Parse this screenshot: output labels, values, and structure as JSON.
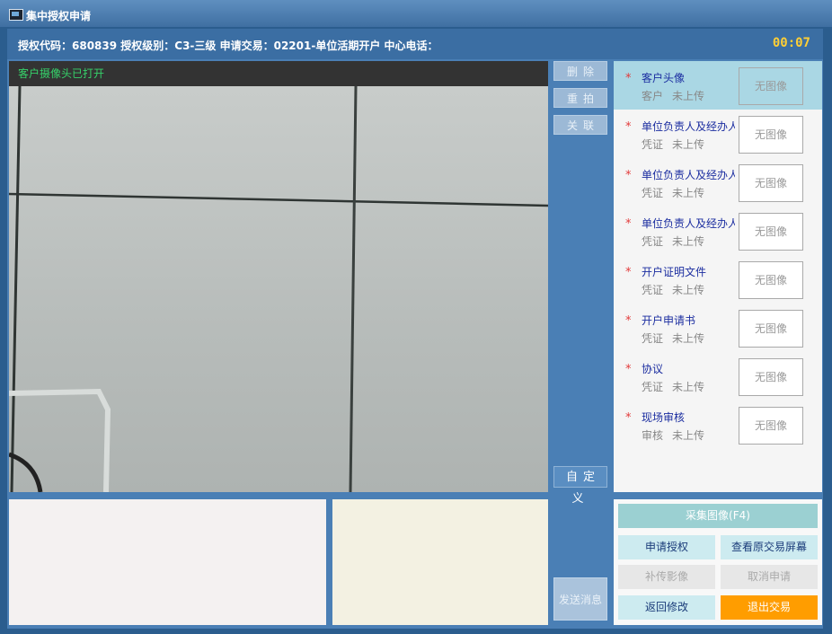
{
  "window": {
    "title": "集中授权申请"
  },
  "header": {
    "info": "授权代码：680839 授权级别：C3-三级 申请交易：02201-单位活期开户 中心电话：",
    "timer": "00:07"
  },
  "camera": {
    "status": "客户摄像头已打开"
  },
  "side_buttons": {
    "delete": "删除",
    "retake": "重拍",
    "link": "关联",
    "custom": "自定义"
  },
  "list": {
    "items": [
      {
        "title": "客户头像",
        "type": "客户",
        "state": "未上传",
        "thumb": "无图像",
        "selected": true
      },
      {
        "title": "单位负责人及经办人",
        "type": "凭证",
        "state": "未上传",
        "thumb": "无图像"
      },
      {
        "title": "单位负责人及经办人",
        "type": "凭证",
        "state": "未上传",
        "thumb": "无图像"
      },
      {
        "title": "单位负责人及经办人",
        "type": "凭证",
        "state": "未上传",
        "thumb": "无图像"
      },
      {
        "title": "开户证明文件",
        "type": "凭证",
        "state": "未上传",
        "thumb": "无图像"
      },
      {
        "title": "开户申请书",
        "type": "凭证",
        "state": "未上传",
        "thumb": "无图像"
      },
      {
        "title": "协议",
        "type": "凭证",
        "state": "未上传",
        "thumb": "无图像"
      },
      {
        "title": "现场审核",
        "type": "审核",
        "state": "未上传",
        "thumb": "无图像"
      }
    ]
  },
  "send_button": "发送消息",
  "actions": {
    "capture": "采集图像(F4)",
    "apply": "申请授权",
    "view_screen": "查看原交易屏幕",
    "reupload": "补传影像",
    "cancel": "取消申请",
    "back": "返回修改",
    "exit": "退出交易"
  }
}
